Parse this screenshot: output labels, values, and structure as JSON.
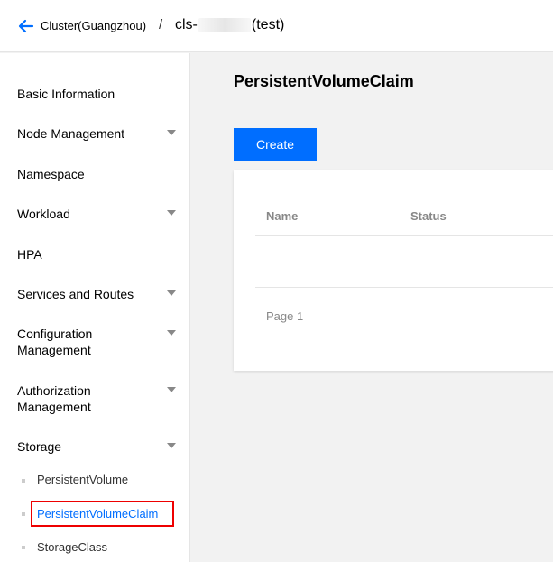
{
  "header": {
    "back_icon": "arrow-left-icon",
    "breadcrumb_parent": "Cluster(Guangzhou)",
    "separator": "/",
    "cluster_prefix": "cls-",
    "cluster_suffix": "(test)",
    "accent_color": "#006eff"
  },
  "sidebar": {
    "items": [
      {
        "label": "Basic Information",
        "expandable": false
      },
      {
        "label": "Node Management",
        "expandable": true
      },
      {
        "label": "Namespace",
        "expandable": false
      },
      {
        "label": "Workload",
        "expandable": true
      },
      {
        "label": "HPA",
        "expandable": false
      },
      {
        "label": "Services and Routes",
        "expandable": true
      },
      {
        "label": "Configuration Management",
        "expandable": true
      },
      {
        "label": "Authorization Management",
        "expandable": true
      },
      {
        "label": "Storage",
        "expandable": true
      }
    ],
    "storage_subitems": [
      {
        "label": "PersistentVolume",
        "active": false
      },
      {
        "label": "PersistentVolumeClaim",
        "active": true
      },
      {
        "label": "StorageClass",
        "active": false
      }
    ]
  },
  "main": {
    "title": "PersistentVolumeClaim",
    "create_label": "Create",
    "columns": [
      "Name",
      "Status"
    ],
    "pagination": "Page 1"
  }
}
